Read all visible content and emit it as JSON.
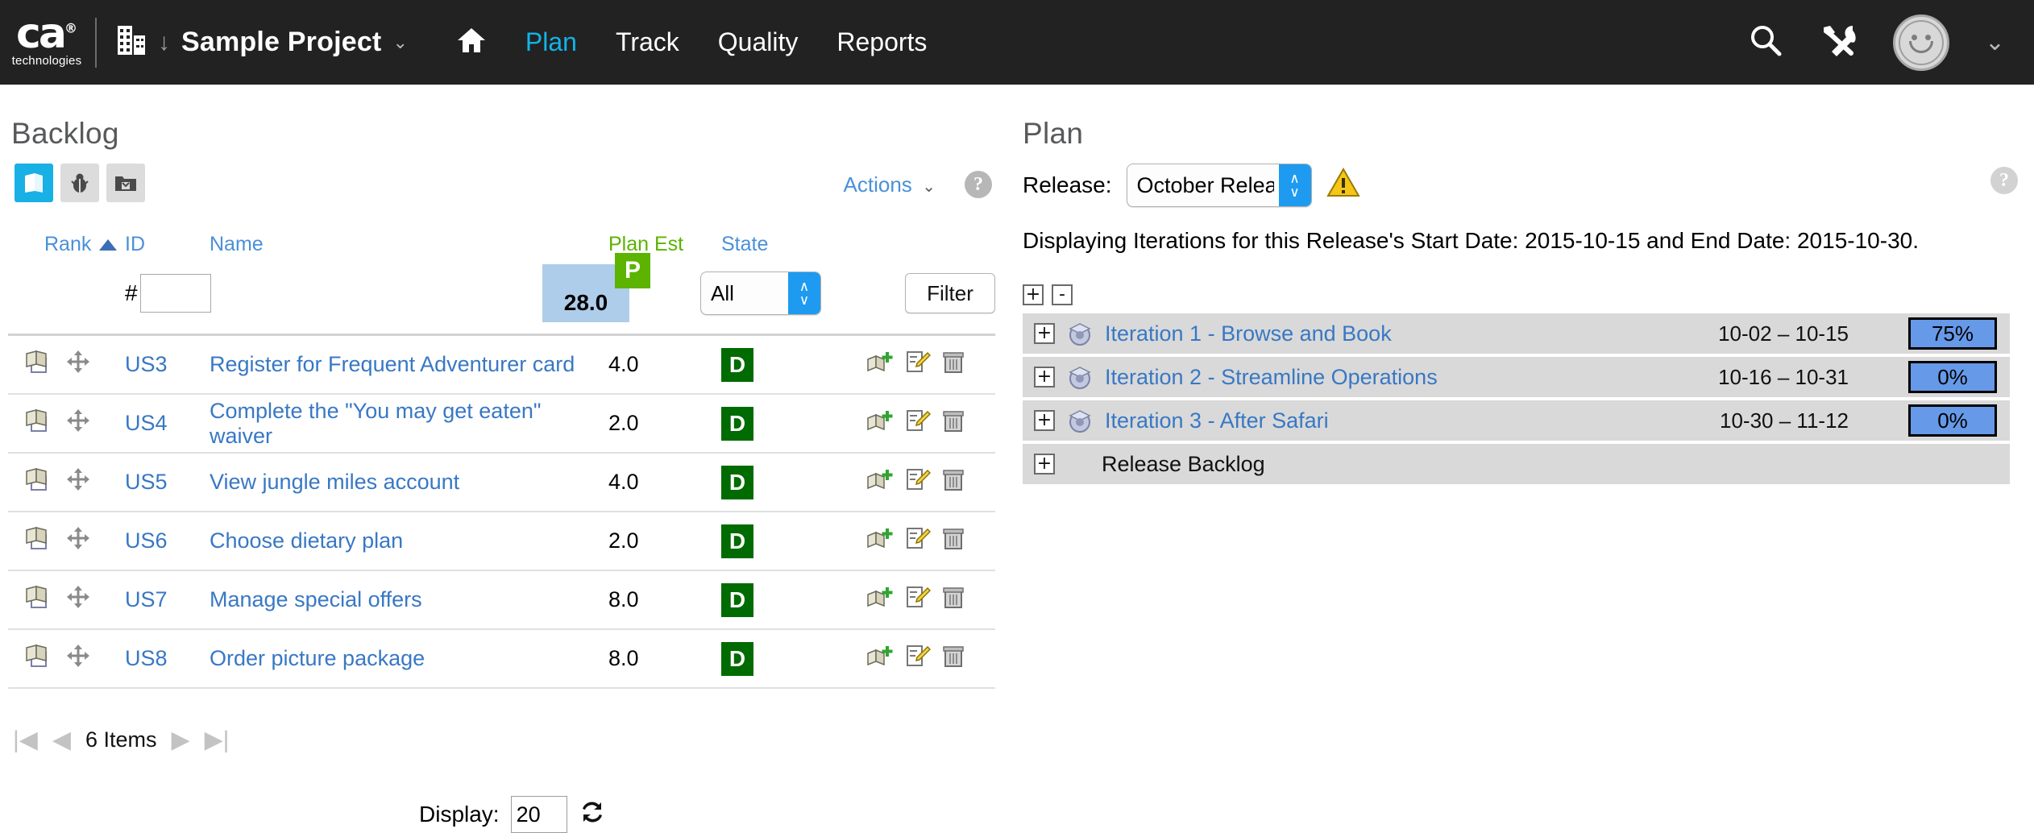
{
  "header": {
    "brand": {
      "logo": "ca",
      "registered": "®",
      "sub": "technologies"
    },
    "project": {
      "name": "Sample Project",
      "building_icon": "building-icon",
      "arrow": "↓",
      "chevron": "⌄"
    },
    "nav": [
      {
        "label": "Plan",
        "active": true
      },
      {
        "label": "Track",
        "active": false
      },
      {
        "label": "Quality",
        "active": false
      },
      {
        "label": "Reports",
        "active": false
      }
    ],
    "home_icon": "home-icon",
    "right_icons": [
      "search-icon",
      "tools-icon",
      "avatar",
      "chevron-down-icon"
    ]
  },
  "backlog": {
    "title": "Backlog",
    "type_tabs": [
      {
        "name": "story-tab",
        "icon": "story-icon",
        "active": true
      },
      {
        "name": "defect-tab",
        "icon": "bug-icon",
        "active": false
      },
      {
        "name": "archive-tab",
        "icon": "folder-icon",
        "active": false
      }
    ],
    "actions_label": "Actions",
    "actions_chevron": "⌄",
    "help": "?",
    "columns": {
      "rank": "Rank",
      "id": "ID",
      "name": "Name",
      "plan_est": "Plan Est",
      "state": "State"
    },
    "sort": {
      "column": "Rank",
      "direction": "asc"
    },
    "filter": {
      "hash": "#",
      "id_value": "",
      "id_placeholder": "",
      "plan_est_total": "28.0",
      "plan_est_badge": "P",
      "state_value": "All",
      "state_options": [
        "All"
      ],
      "filter_button": "Filter"
    },
    "rows": [
      {
        "id": "US3",
        "name": "Register for Frequent Adventurer card",
        "plan_est": "4.0",
        "state": "D"
      },
      {
        "id": "US4",
        "name": "Complete the \"You may get eaten\" waiver",
        "plan_est": "2.0",
        "state": "D"
      },
      {
        "id": "US5",
        "name": "View jungle miles account",
        "plan_est": "4.0",
        "state": "D"
      },
      {
        "id": "US6",
        "name": "Choose dietary plan",
        "plan_est": "2.0",
        "state": "D"
      },
      {
        "id": "US7",
        "name": "Manage special offers",
        "plan_est": "8.0",
        "state": "D"
      },
      {
        "id": "US8",
        "name": "Order picture package",
        "plan_est": "8.0",
        "state": "D"
      }
    ],
    "pager": {
      "first": "|◀",
      "prev": "◀",
      "count": "6 Items",
      "next": "▶",
      "last": "▶|"
    },
    "display": {
      "label": "Display:",
      "value": "20",
      "refresh_icon": "refresh-icon"
    }
  },
  "plan": {
    "title": "Plan",
    "release_label": "Release:",
    "release_value": "October Release",
    "release_options": [
      "October Release"
    ],
    "warning_icon": "warning-icon",
    "help": "?",
    "message": "Displaying Iterations for this Release's Start Date: 2015-10-15 and End Date: 2015-10-30.",
    "expand_all": "+",
    "collapse_all": "-",
    "iterations": [
      {
        "expander": "+",
        "name": "Iteration 1 - Browse and Book",
        "dates": "10-02 – 10-15",
        "progress": "75%",
        "has_icon": true
      },
      {
        "expander": "+",
        "name": "Iteration 2 - Streamline Operations",
        "dates": "10-16 – 10-31",
        "progress": "0%",
        "has_icon": true
      },
      {
        "expander": "+",
        "name": "Iteration 3 - After Safari",
        "dates": "10-30 – 11-12",
        "progress": "0%",
        "has_icon": true
      },
      {
        "expander": "+",
        "name": "Release Backlog",
        "dates": "",
        "progress": "",
        "has_icon": false
      }
    ]
  },
  "colors": {
    "topbar": "#222222",
    "accent_cyan": "#11b4e8",
    "link_blue": "#3878c4",
    "state_green": "#006b00",
    "badge_green": "#5cb300",
    "est_highlight": "#aecdea",
    "progress_blue": "#6699e8",
    "row_gray": "#d9d9d9"
  }
}
